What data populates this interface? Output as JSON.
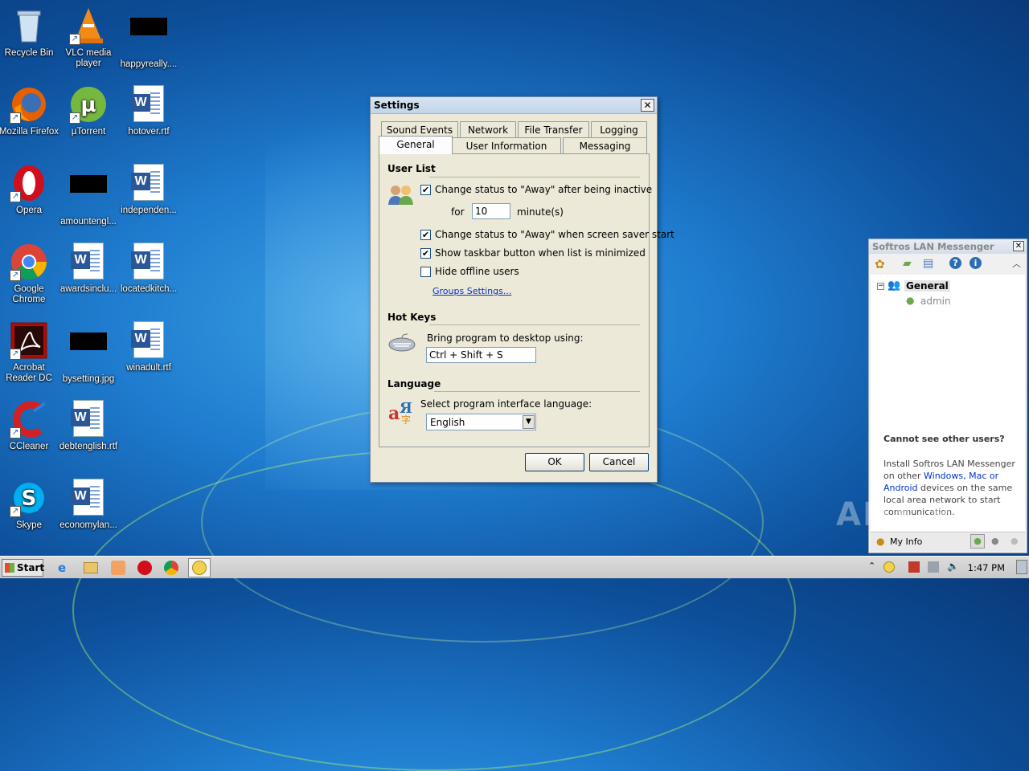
{
  "desktop": {
    "icons": [
      {
        "label": "Recycle Bin"
      },
      {
        "label": "VLC media player"
      },
      {
        "label": "happyreally...."
      },
      {
        "label": "Mozilla Firefox"
      },
      {
        "label": "µTorrent"
      },
      {
        "label": "hotover.rtf"
      },
      {
        "label": "Opera"
      },
      {
        "label": "amountengl..."
      },
      {
        "label": "independen..."
      },
      {
        "label": "Google Chrome"
      },
      {
        "label": "awardsinclu..."
      },
      {
        "label": "locatedkitch..."
      },
      {
        "label": "Acrobat Reader DC"
      },
      {
        "label": "bysetting.jpg"
      },
      {
        "label": "winadult.rtf"
      },
      {
        "label": "CCleaner"
      },
      {
        "label": "debtenglish.rtf"
      },
      {
        "label": "Skype"
      },
      {
        "label": "economylan..."
      }
    ]
  },
  "settings": {
    "title": "Settings",
    "close": "✕",
    "tabs_row1": [
      "Sound Events",
      "Network",
      "File Transfer",
      "Logging"
    ],
    "tabs_row2": [
      "General",
      "User Information",
      "Messaging"
    ],
    "user_list": {
      "heading": "User List",
      "away_inactive": {
        "label": "Change status to \"Away\" after being inactive",
        "checked": true
      },
      "for_label": "for",
      "minutes_value": "10",
      "minutes_label": "minute(s)",
      "away_screensaver": {
        "label": "Change status to \"Away\" when screen saver start",
        "checked": true
      },
      "taskbar_button": {
        "label": "Show taskbar button when list is minimized",
        "checked": true
      },
      "hide_offline": {
        "label": "Hide offline users",
        "checked": false
      },
      "groups_link": "Groups Settings..."
    },
    "hot_keys": {
      "heading": "Hot Keys",
      "label": "Bring program to desktop using:",
      "value": "Ctrl + Shift + S"
    },
    "language": {
      "heading": "Language",
      "label": "Select program interface language:",
      "value": "English"
    },
    "ok": "OK",
    "cancel": "Cancel"
  },
  "messenger": {
    "title": "Softros LAN Messenger",
    "group": "General",
    "user": "admin",
    "cannot_see": "Cannot see other users?",
    "install_text_1": "Install Softros LAN Messenger on other ",
    "link_text": "Windows, Mac or Android",
    "install_text_2": " devices on the same local area network to start communication.",
    "my_info": "My Info"
  },
  "taskbar": {
    "start": "Start",
    "time": "1:47 PM"
  },
  "watermark": "ANY RUN",
  "colors": {
    "accent": "#1c5180",
    "link": "#0033cc",
    "dialog_bg": "#ece9d8"
  }
}
